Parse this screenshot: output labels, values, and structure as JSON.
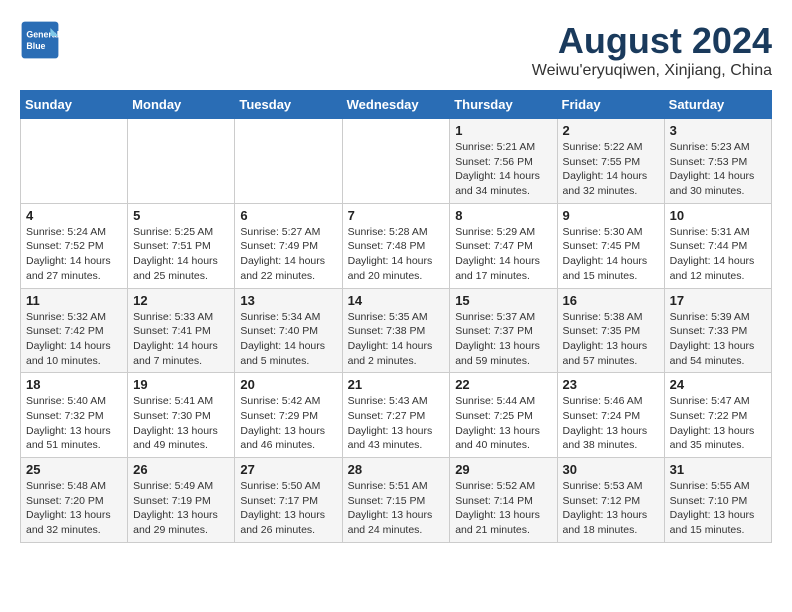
{
  "header": {
    "logo_line1": "General",
    "logo_line2": "Blue",
    "month": "August 2024",
    "location": "Weiwu'eryuqiwen, Xinjiang, China"
  },
  "days_of_week": [
    "Sunday",
    "Monday",
    "Tuesday",
    "Wednesday",
    "Thursday",
    "Friday",
    "Saturday"
  ],
  "weeks": [
    [
      {
        "day": "",
        "info": ""
      },
      {
        "day": "",
        "info": ""
      },
      {
        "day": "",
        "info": ""
      },
      {
        "day": "",
        "info": ""
      },
      {
        "day": "1",
        "info": "Sunrise: 5:21 AM\nSunset: 7:56 PM\nDaylight: 14 hours\nand 34 minutes."
      },
      {
        "day": "2",
        "info": "Sunrise: 5:22 AM\nSunset: 7:55 PM\nDaylight: 14 hours\nand 32 minutes."
      },
      {
        "day": "3",
        "info": "Sunrise: 5:23 AM\nSunset: 7:53 PM\nDaylight: 14 hours\nand 30 minutes."
      }
    ],
    [
      {
        "day": "4",
        "info": "Sunrise: 5:24 AM\nSunset: 7:52 PM\nDaylight: 14 hours\nand 27 minutes."
      },
      {
        "day": "5",
        "info": "Sunrise: 5:25 AM\nSunset: 7:51 PM\nDaylight: 14 hours\nand 25 minutes."
      },
      {
        "day": "6",
        "info": "Sunrise: 5:27 AM\nSunset: 7:49 PM\nDaylight: 14 hours\nand 22 minutes."
      },
      {
        "day": "7",
        "info": "Sunrise: 5:28 AM\nSunset: 7:48 PM\nDaylight: 14 hours\nand 20 minutes."
      },
      {
        "day": "8",
        "info": "Sunrise: 5:29 AM\nSunset: 7:47 PM\nDaylight: 14 hours\nand 17 minutes."
      },
      {
        "day": "9",
        "info": "Sunrise: 5:30 AM\nSunset: 7:45 PM\nDaylight: 14 hours\nand 15 minutes."
      },
      {
        "day": "10",
        "info": "Sunrise: 5:31 AM\nSunset: 7:44 PM\nDaylight: 14 hours\nand 12 minutes."
      }
    ],
    [
      {
        "day": "11",
        "info": "Sunrise: 5:32 AM\nSunset: 7:42 PM\nDaylight: 14 hours\nand 10 minutes."
      },
      {
        "day": "12",
        "info": "Sunrise: 5:33 AM\nSunset: 7:41 PM\nDaylight: 14 hours\nand 7 minutes."
      },
      {
        "day": "13",
        "info": "Sunrise: 5:34 AM\nSunset: 7:40 PM\nDaylight: 14 hours\nand 5 minutes."
      },
      {
        "day": "14",
        "info": "Sunrise: 5:35 AM\nSunset: 7:38 PM\nDaylight: 14 hours\nand 2 minutes."
      },
      {
        "day": "15",
        "info": "Sunrise: 5:37 AM\nSunset: 7:37 PM\nDaylight: 13 hours\nand 59 minutes."
      },
      {
        "day": "16",
        "info": "Sunrise: 5:38 AM\nSunset: 7:35 PM\nDaylight: 13 hours\nand 57 minutes."
      },
      {
        "day": "17",
        "info": "Sunrise: 5:39 AM\nSunset: 7:33 PM\nDaylight: 13 hours\nand 54 minutes."
      }
    ],
    [
      {
        "day": "18",
        "info": "Sunrise: 5:40 AM\nSunset: 7:32 PM\nDaylight: 13 hours\nand 51 minutes."
      },
      {
        "day": "19",
        "info": "Sunrise: 5:41 AM\nSunset: 7:30 PM\nDaylight: 13 hours\nand 49 minutes."
      },
      {
        "day": "20",
        "info": "Sunrise: 5:42 AM\nSunset: 7:29 PM\nDaylight: 13 hours\nand 46 minutes."
      },
      {
        "day": "21",
        "info": "Sunrise: 5:43 AM\nSunset: 7:27 PM\nDaylight: 13 hours\nand 43 minutes."
      },
      {
        "day": "22",
        "info": "Sunrise: 5:44 AM\nSunset: 7:25 PM\nDaylight: 13 hours\nand 40 minutes."
      },
      {
        "day": "23",
        "info": "Sunrise: 5:46 AM\nSunset: 7:24 PM\nDaylight: 13 hours\nand 38 minutes."
      },
      {
        "day": "24",
        "info": "Sunrise: 5:47 AM\nSunset: 7:22 PM\nDaylight: 13 hours\nand 35 minutes."
      }
    ],
    [
      {
        "day": "25",
        "info": "Sunrise: 5:48 AM\nSunset: 7:20 PM\nDaylight: 13 hours\nand 32 minutes."
      },
      {
        "day": "26",
        "info": "Sunrise: 5:49 AM\nSunset: 7:19 PM\nDaylight: 13 hours\nand 29 minutes."
      },
      {
        "day": "27",
        "info": "Sunrise: 5:50 AM\nSunset: 7:17 PM\nDaylight: 13 hours\nand 26 minutes."
      },
      {
        "day": "28",
        "info": "Sunrise: 5:51 AM\nSunset: 7:15 PM\nDaylight: 13 hours\nand 24 minutes."
      },
      {
        "day": "29",
        "info": "Sunrise: 5:52 AM\nSunset: 7:14 PM\nDaylight: 13 hours\nand 21 minutes."
      },
      {
        "day": "30",
        "info": "Sunrise: 5:53 AM\nSunset: 7:12 PM\nDaylight: 13 hours\nand 18 minutes."
      },
      {
        "day": "31",
        "info": "Sunrise: 5:55 AM\nSunset: 7:10 PM\nDaylight: 13 hours\nand 15 minutes."
      }
    ]
  ]
}
